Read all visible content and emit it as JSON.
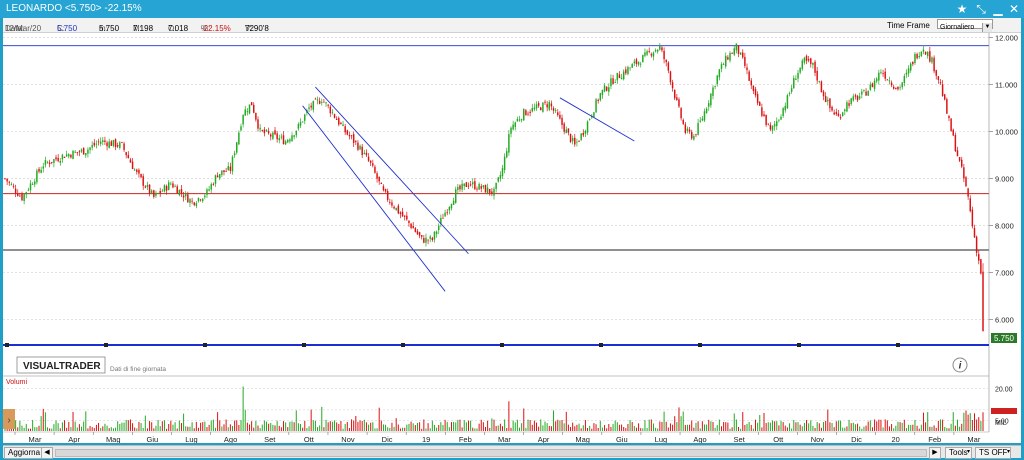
{
  "window": {
    "title": "LEONARDO <5.750> -22.15%"
  },
  "infobar": {
    "data_label": "Data:",
    "data_value": "12/Mar/20",
    "c_label": "C:",
    "c_value": "5.750",
    "m_label": "m:",
    "m_value": "5.750",
    "M_label": "M:",
    "M_value": "7.198",
    "o_label": "O:",
    "o_value": "7.018",
    "pct_label": "%:",
    "pct_value": "-22.15%",
    "v_label": "V:",
    "v_value": "7290'8"
  },
  "timeframe": {
    "label": "Time Frame",
    "selected": "Giornaliero"
  },
  "brand": {
    "name": "VISUALTRADER",
    "subtitle": "Dati di fine giornata"
  },
  "volume": {
    "title": "Volumi",
    "ticks": [
      "20.00",
      "10.00",
      "5.00",
      "10",
      "MIL"
    ],
    "tick_values": [
      20,
      10,
      5,
      10
    ]
  },
  "bottombar": {
    "refresh": "Aggiorna",
    "tools": "Tools",
    "ts": "TS OFF"
  },
  "chart_data": {
    "type": "candlestick",
    "ylim": [
      5.5,
      12.1
    ],
    "yticks": [
      "12.000",
      "11.000",
      "10.000",
      "9.000",
      "8.000",
      "7.000",
      "6.000"
    ],
    "ytick_values": [
      12,
      11,
      10,
      9,
      8,
      7,
      6
    ],
    "last_price": "5.750",
    "last_price_value": 5.75,
    "months": [
      "Mar",
      "Apr",
      "Mag",
      "Giu",
      "Lug",
      "Ago",
      "Set",
      "Ott",
      "Nov",
      "Dic",
      "19",
      "Feb",
      "Mar",
      "Apr",
      "Mag",
      "Giu",
      "Lug",
      "Ago",
      "Set",
      "Ott",
      "Nov",
      "Dic",
      "20",
      "Feb",
      "Mar"
    ],
    "close_path": [
      [
        0,
        9.0
      ],
      [
        8,
        8.6
      ],
      [
        18,
        9.3
      ],
      [
        28,
        9.5
      ],
      [
        38,
        9.6
      ],
      [
        45,
        9.8
      ],
      [
        55,
        9.7
      ],
      [
        62,
        9.1
      ],
      [
        70,
        8.6
      ],
      [
        78,
        8.9
      ],
      [
        88,
        8.5
      ],
      [
        95,
        8.7
      ],
      [
        100,
        9.1
      ],
      [
        106,
        9.2
      ],
      [
        112,
        10.4
      ],
      [
        116,
        10.6
      ],
      [
        120,
        10.0
      ],
      [
        126,
        9.9
      ],
      [
        132,
        9.8
      ],
      [
        138,
        10.1
      ],
      [
        143,
        10.5
      ],
      [
        149,
        10.7
      ],
      [
        154,
        10.4
      ],
      [
        160,
        10.0
      ],
      [
        166,
        9.7
      ],
      [
        172,
        9.3
      ],
      [
        178,
        8.7
      ],
      [
        185,
        8.3
      ],
      [
        191,
        8.0
      ],
      [
        196,
        7.7
      ],
      [
        201,
        7.7
      ],
      [
        206,
        8.2
      ],
      [
        212,
        8.7
      ],
      [
        218,
        8.9
      ],
      [
        224,
        8.8
      ],
      [
        230,
        8.7
      ],
      [
        234,
        9.2
      ],
      [
        238,
        10.1
      ],
      [
        244,
        10.4
      ],
      [
        250,
        10.5
      ],
      [
        256,
        10.6
      ],
      [
        260,
        10.3
      ],
      [
        264,
        10.0
      ],
      [
        268,
        9.7
      ],
      [
        272,
        10.0
      ],
      [
        276,
        10.4
      ],
      [
        280,
        10.8
      ],
      [
        286,
        11.1
      ],
      [
        292,
        11.3
      ],
      [
        298,
        11.5
      ],
      [
        304,
        11.7
      ],
      [
        308,
        11.8
      ],
      [
        312,
        11.3
      ],
      [
        316,
        10.6
      ],
      [
        320,
        10.0
      ],
      [
        324,
        9.9
      ],
      [
        328,
        10.3
      ],
      [
        332,
        10.8
      ],
      [
        336,
        11.3
      ],
      [
        340,
        11.6
      ],
      [
        344,
        11.8
      ],
      [
        348,
        11.4
      ],
      [
        352,
        10.8
      ],
      [
        356,
        10.4
      ],
      [
        360,
        10.0
      ],
      [
        364,
        10.3
      ],
      [
        368,
        10.7
      ],
      [
        372,
        11.2
      ],
      [
        376,
        11.5
      ],
      [
        380,
        11.4
      ],
      [
        384,
        10.9
      ],
      [
        388,
        10.5
      ],
      [
        392,
        10.3
      ],
      [
        396,
        10.6
      ],
      [
        400,
        10.7
      ],
      [
        404,
        10.8
      ],
      [
        408,
        11.0
      ],
      [
        412,
        11.3
      ],
      [
        416,
        11.1
      ],
      [
        420,
        10.9
      ],
      [
        424,
        11.2
      ],
      [
        428,
        11.6
      ],
      [
        432,
        11.8
      ],
      [
        436,
        11.5
      ],
      [
        440,
        11.0
      ],
      [
        444,
        10.2
      ],
      [
        448,
        9.5
      ],
      [
        451,
        9.0
      ],
      [
        453,
        8.6
      ],
      [
        455,
        8.0
      ],
      [
        457,
        7.5
      ],
      [
        459,
        7.0
      ],
      [
        460,
        5.75
      ]
    ],
    "support_lines": [
      {
        "color": "#1b33c8",
        "y": 11.83
      },
      {
        "color": "#cc2222",
        "y": 8.68
      },
      {
        "color": "#222222",
        "y": 7.48
      }
    ],
    "trend_lines": [
      {
        "color": "#2233cc",
        "from": [
          146,
          10.95
        ],
        "to": [
          218,
          7.4
        ]
      },
      {
        "color": "#2233cc",
        "from": [
          140,
          10.55
        ],
        "to": [
          207,
          6.6
        ]
      },
      {
        "color": "#2233cc",
        "from": [
          261,
          10.72
        ],
        "to": [
          296,
          9.8
        ]
      }
    ]
  }
}
